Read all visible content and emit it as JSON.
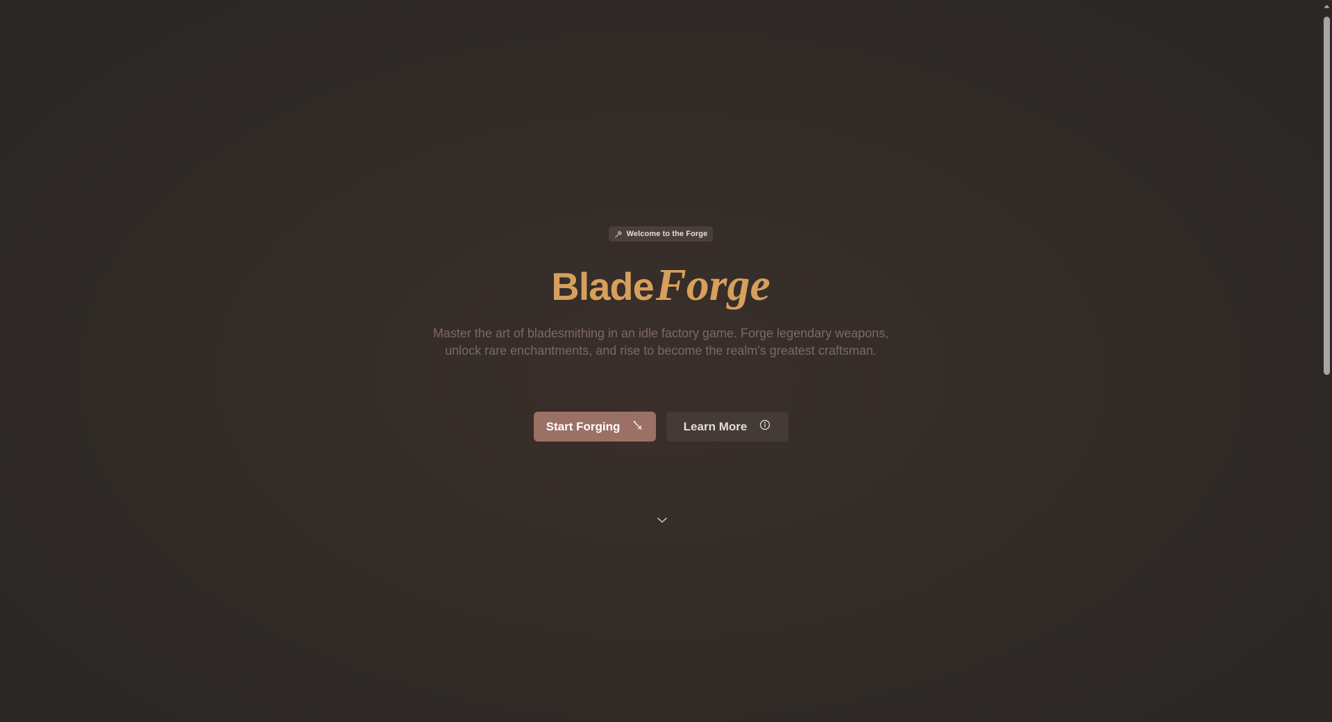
{
  "hero": {
    "badge_label": "Welcome to the Forge",
    "badge_icon": "hammer-icon",
    "title_part1": "Blade",
    "title_part2": "Forge",
    "subtitle_line1": "Master the art of bladesmithing in an idle factory game. Forge legendary weapons,",
    "subtitle_line2": "unlock rare enchantments, and rise to become the realm's greatest craftsman."
  },
  "actions": {
    "primary_label": "Start Forging",
    "primary_icon": "sword-icon",
    "secondary_label": "Learn More",
    "secondary_icon": "info-icon"
  },
  "scroll_hint_icon": "chevron-down-icon",
  "colors": {
    "background": "#2c2825",
    "accent_gold": "#d6a05c",
    "primary_button": "#9b7166",
    "secondary_button": "#443b38",
    "muted_text": "#7e6864"
  }
}
